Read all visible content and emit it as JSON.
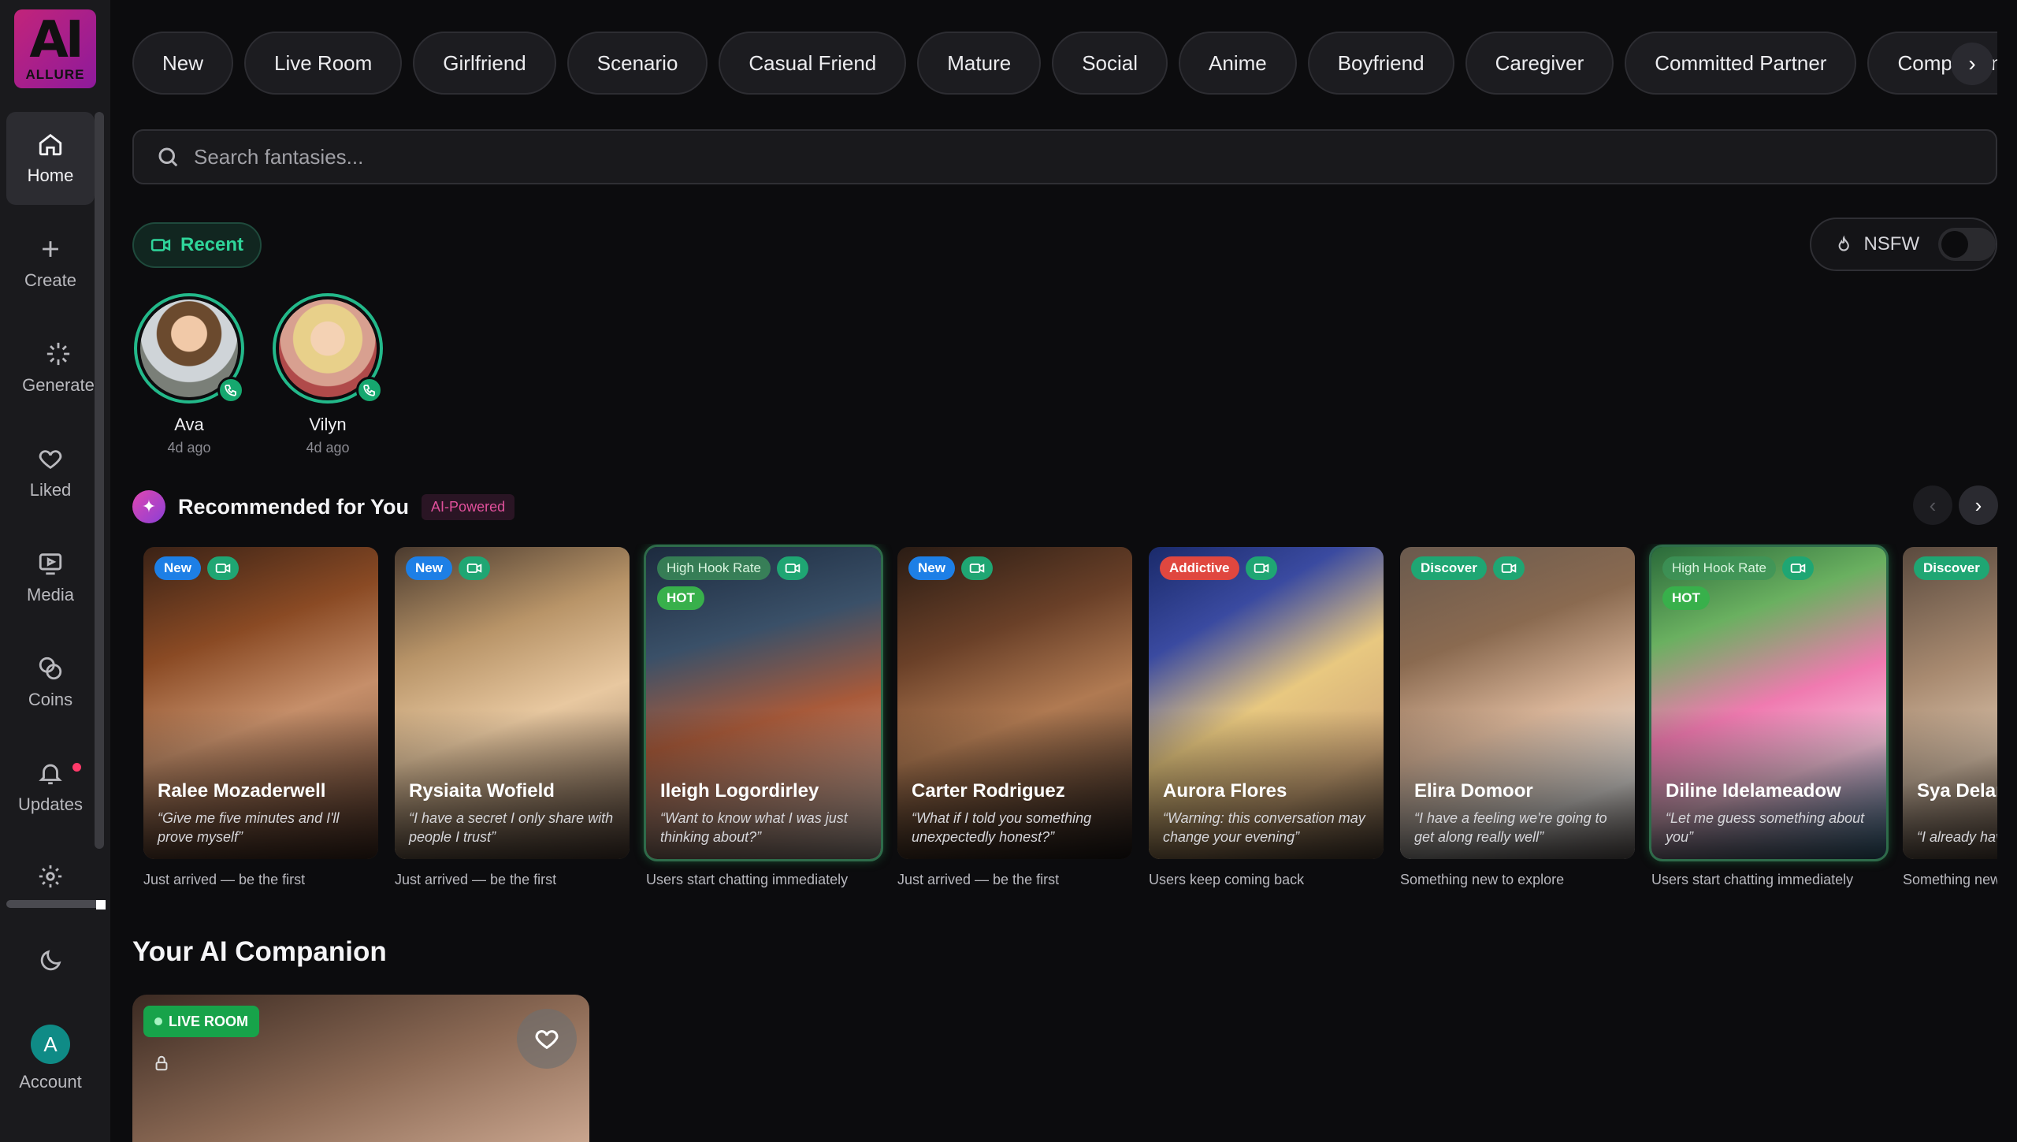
{
  "logo": {
    "mark": "AI",
    "word": "ALLURE"
  },
  "sidebar": {
    "items": [
      {
        "label": "Home",
        "icon": "home-icon"
      },
      {
        "label": "Create",
        "icon": "plus-icon"
      },
      {
        "label": "Generate",
        "icon": "sparkle-icon"
      },
      {
        "label": "Liked",
        "icon": "heart-icon"
      },
      {
        "label": "Media",
        "icon": "media-icon"
      },
      {
        "label": "Coins",
        "icon": "coins-icon"
      },
      {
        "label": "Updates",
        "icon": "bell-icon"
      }
    ],
    "account_initial": "A",
    "account_label": "Account"
  },
  "categories": [
    "New",
    "Live Room",
    "Girlfriend",
    "Scenario",
    "Casual Friend",
    "Mature",
    "Social",
    "Anime",
    "Boyfriend",
    "Caregiver",
    "Committed Partner",
    "Companion"
  ],
  "search": {
    "placeholder": "Search fantasies..."
  },
  "recent": {
    "button_label": "Recent",
    "nsfw_label": "NSFW",
    "nsfw_on": false,
    "people": [
      {
        "name": "Ava",
        "ago": "4d ago"
      },
      {
        "name": "Vilyn",
        "ago": "4d ago"
      }
    ]
  },
  "recommended": {
    "title": "Recommended for You",
    "badge": "AI-Powered",
    "cards": [
      {
        "name": "Ralee Mozaderwell",
        "quote": "“Give me five minutes and I'll prove myself”",
        "sub": "Just arrived — be the first",
        "tags": [
          "New"
        ],
        "glow": false
      },
      {
        "name": "Rysiaita Wofield",
        "quote": "“I have a secret I only share with people I trust”",
        "sub": "Just arrived — be the first",
        "tags": [
          "New"
        ],
        "glow": false
      },
      {
        "name": "Ileigh Logordirley",
        "quote": "“Want to know what I was just thinking about?”",
        "sub": "Users start chatting immediately",
        "tags": [
          "High Hook Rate",
          "HOT"
        ],
        "glow": true
      },
      {
        "name": "Carter Rodriguez",
        "quote": "“What if I told you something unexpectedly honest?”",
        "sub": "Just arrived — be the first",
        "tags": [
          "New"
        ],
        "glow": false
      },
      {
        "name": "Aurora Flores",
        "quote": "“Warning: this conversation may change your evening”",
        "sub": "Users keep coming back",
        "tags": [
          "Addictive"
        ],
        "glow": false
      },
      {
        "name": "Elira Domoor",
        "quote": "“I have a feeling we're going to get along really well”",
        "sub": "Something new to explore",
        "tags": [
          "Discover"
        ],
        "glow": false
      },
      {
        "name": "Diline Idelameadow",
        "quote": "“Let me guess something about you”",
        "sub": "Users start chatting immediately",
        "tags": [
          "High Hook Rate",
          "HOT"
        ],
        "glow": true
      },
      {
        "name": "Sya Delane",
        "quote": "“I already have a good feeling”",
        "sub": "Something new to explore",
        "tags": [
          "Discover"
        ],
        "glow": false
      }
    ]
  },
  "companion": {
    "title": "Your AI Companion",
    "live_label": "LIVE ROOM"
  },
  "colors": {
    "accent_green": "#2fd59a",
    "brand_pink": "#c2247a",
    "badge_pink": "#e0509b"
  }
}
